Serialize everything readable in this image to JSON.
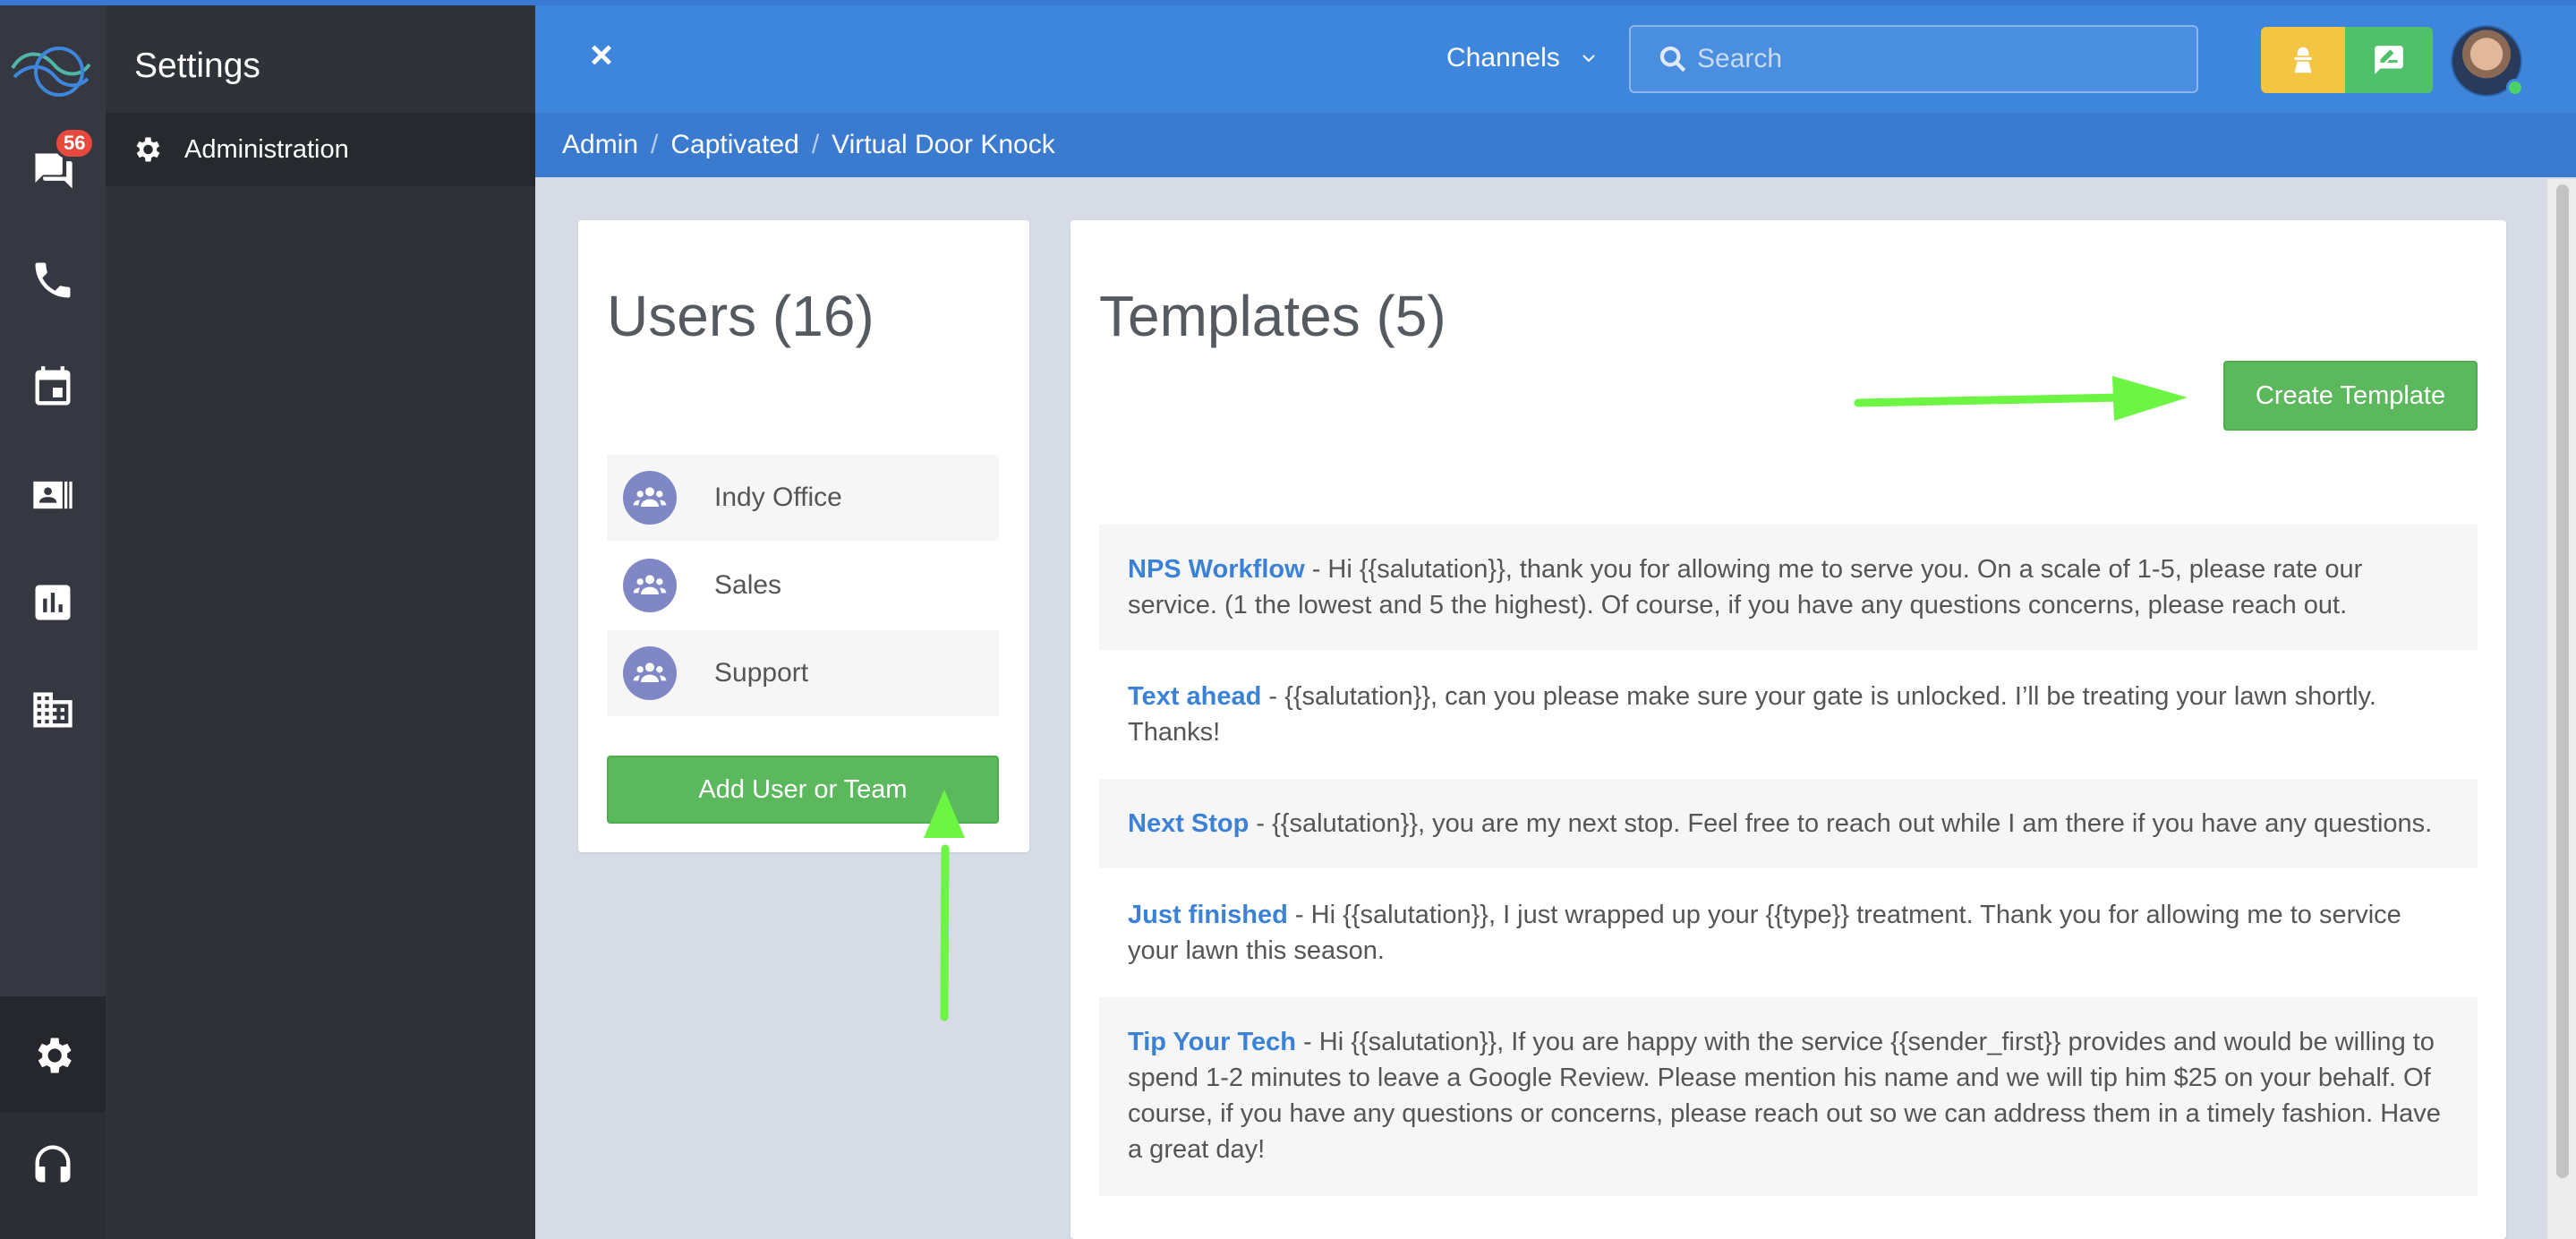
{
  "nav": {
    "badge_count": "56",
    "icons": [
      "chat-icon",
      "phone-icon",
      "calendar-icon",
      "contacts-icon",
      "reports-icon",
      "building-icon",
      "gear-icon",
      "headset-icon"
    ]
  },
  "sidebar": {
    "title": "Settings",
    "items": [
      {
        "label": "Administration",
        "icon": "gear-icon"
      }
    ]
  },
  "header": {
    "close_label": "×",
    "channels_label": "Channels",
    "search_placeholder": "Search"
  },
  "breadcrumb": [
    "Admin",
    "Captivated",
    "Virtual Door Knock"
  ],
  "users": {
    "title": "Users (16)",
    "teams": [
      {
        "label": "Indy Office"
      },
      {
        "label": "Sales"
      },
      {
        "label": "Support"
      }
    ],
    "add_button": "Add User or Team"
  },
  "templates": {
    "title": "Templates (5)",
    "create_button": "Create Template",
    "items": [
      {
        "name": "NPS Workflow",
        "body": " - Hi {{salutation}}, thank you for allowing me to serve you. On a scale of 1-5, please rate our service. (1 the lowest and 5 the highest). Of course, if you have any questions concerns, please reach out."
      },
      {
        "name": "Text ahead",
        "body": " - {{salutation}}, can you please make sure your gate is unlocked. I’ll be treating your lawn shortly. Thanks!"
      },
      {
        "name": "Next Stop",
        "body": " - {{salutation}}, you are my next stop. Feel free to reach out while I am there if you have any questions."
      },
      {
        "name": "Just finished",
        "body": " - Hi {{salutation}}, I just wrapped up your {{type}} treatment. Thank you for allowing me to service your lawn this season."
      },
      {
        "name": "Tip Your Tech",
        "body": " - Hi {{salutation}}, If you are happy with the service {{sender_first}} provides and would be willing to spend 1-2 minutes to leave a Google Review. Please mention his name and we will tip him $25 on your behalf. Of course, if you have any questions or concerns, please reach out so we can address them in a timely fashion. Have a great day!"
      }
    ]
  },
  "colors": {
    "header_blue": "#3e86dc",
    "accent_green": "#5cb85c",
    "link_blue": "#3b82d6",
    "annotation_arrow": "#6cf542",
    "badge_red": "#e8493f"
  }
}
